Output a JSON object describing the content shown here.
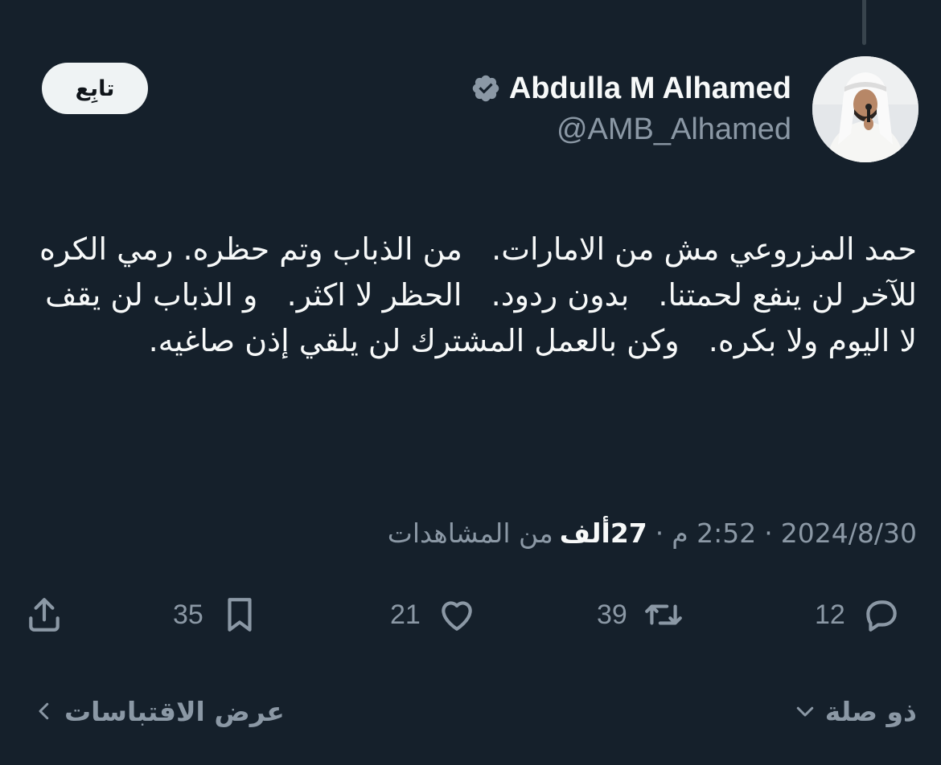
{
  "author": {
    "display_name": "Abdulla M Alhamed",
    "handle": "@AMB_Alhamed",
    "verified_color": "#8b98a5"
  },
  "follow_label": "تابِع",
  "tweet": {
    "text": "حمد المزروعي مش من الامارات.   من الذباب وتم حظره. رمي الكره للآخر لن ينفع لحمتنا.   بدون ردود.   الحظر لا اكثر.   و الذباب لن يقف لا اليوم ولا بكره.   وكن بالعمل المشترك لن يلقي إذن صاغيه."
  },
  "meta": {
    "date": "2024/8/30",
    "time": "2:52 م",
    "separator": "·",
    "views_count": "27ألف",
    "views_label": "من المشاهدات"
  },
  "actions": {
    "replies": "12",
    "reposts": "39",
    "likes": "21",
    "bookmarks": "35"
  },
  "footer": {
    "related_label": "ذو صلة",
    "quotes_label": "عرض الاقتباسات"
  },
  "colors": {
    "background": "#15202b",
    "text_primary": "#f7f9f9",
    "text_secondary": "#8b98a5",
    "follow_bg": "#eff3f4"
  }
}
